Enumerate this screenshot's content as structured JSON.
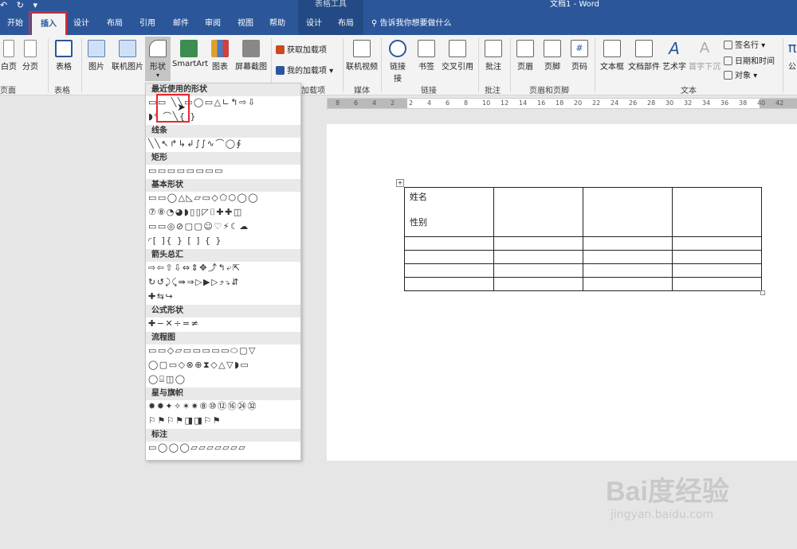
{
  "titlebar": {
    "qat_icons": [
      "undo-arrow",
      "redo-icon",
      "customize-qat"
    ],
    "context_header": "表格工具",
    "title": "文档1 - Word"
  },
  "tabs": [
    {
      "label": "开始",
      "active": false
    },
    {
      "label": "插入",
      "active": true
    },
    {
      "label": "设计",
      "active": false
    },
    {
      "label": "布局",
      "active": false
    },
    {
      "label": "引用",
      "active": false
    },
    {
      "label": "邮件",
      "active": false
    },
    {
      "label": "审阅",
      "active": false
    },
    {
      "label": "视图",
      "active": false
    },
    {
      "label": "帮助",
      "active": false
    },
    {
      "label": "设计",
      "active": false
    },
    {
      "label": "布局",
      "active": false
    }
  ],
  "search_tab": "告诉我你想要做什么",
  "ribbon": {
    "buttons": {
      "page_partial": "白页",
      "page_break": "分页",
      "table": "表格",
      "picture": "图片",
      "online_picture": "联机图片",
      "shapes": "形状",
      "smartart": "SmartArt",
      "chart": "图表",
      "screenshot": "屏幕截图",
      "get_addins": "获取加载项",
      "my_addins": "我的加载项",
      "online_video": "联机视频",
      "link": "链接",
      "link2": "接",
      "bookmark": "书签",
      "crossref": "交叉引用",
      "comment": "批注",
      "header": "页眉",
      "footer": "页脚",
      "page_number": "页码",
      "textbox": "文本框",
      "quickparts": "文档部件",
      "wordart": "艺术字",
      "dropcap": "首字下沉",
      "signature": "签名行",
      "datetime": "日期和时间",
      "object": "对象",
      "formula_partial": "公"
    },
    "groups": {
      "pages": "页面",
      "tables": "表格",
      "addins": "加载项",
      "media": "媒体",
      "links": "链接",
      "comments": "批注",
      "headerfooter": "页眉和页脚",
      "text": "文本"
    }
  },
  "ruler": {
    "labels": [
      "8",
      "6",
      "4",
      "2",
      "2",
      "4",
      "6",
      "8",
      "10",
      "12",
      "14",
      "16",
      "18",
      "20",
      "22",
      "24",
      "26",
      "28",
      "30",
      "32",
      "34",
      "36",
      "38",
      "40",
      "42"
    ]
  },
  "document": {
    "cell_line1": "姓名",
    "cell_line2": "性别"
  },
  "shapes_panel": {
    "categories": [
      {
        "title": "最近使用的形状",
        "rows": [
          "▭▭ ╲╲▭◯▭△∟↰⇨⇩",
          "◗⁴ ⌒╲{ }"
        ]
      },
      {
        "title": "线条",
        "rows": [
          "╲╲↖↱↳↲∫∫∿⌒◯∮"
        ]
      },
      {
        "title": "矩形",
        "rows": [
          "▭▭▭▭▭▭▭▭"
        ]
      },
      {
        "title": "基本形状",
        "rows": [
          "▭▭◯△◺▱▭◇⬠⬡◯◯",
          "⑦⑧◔◕◗▯▯◸⌷✚✚◫",
          "▭▭◎⊘▢▢☺♡⚡☾☁",
          "◜[ ]{ } [ ] { }"
        ]
      },
      {
        "title": "箭头总汇",
        "rows": [
          "⇨⇦⇧⇩⇔⇕✥⤴↰⤶⇱",
          "↻↺⤸⤹⇛⇒▷▶▷⤴⤵⇵",
          "✚⇆↪"
        ]
      },
      {
        "title": "公式形状",
        "rows": [
          "✚−✕÷=≠"
        ]
      },
      {
        "title": "流程图",
        "rows": [
          "▭▭◇▱▭▭▭▭▭⬭▢▽",
          "◯▢▭◇⊗⊕⧗◇△▽◗▭",
          "◯⌸◫◯"
        ]
      },
      {
        "title": "星与旗帜",
        "rows": [
          "✸✹✦✧✶✷⑧⑩⑫⑯㉔㉜",
          "⚐⚑⚐⚑◨◨⚐⚑"
        ]
      },
      {
        "title": "标注",
        "rows": [
          "▭◯◯◯▱▱▱▱▱▱▱",
          "▱▱▱▱"
        ]
      }
    ]
  },
  "watermark": {
    "logo": "Bai度经验",
    "url": "jingyan.baidu.com"
  }
}
